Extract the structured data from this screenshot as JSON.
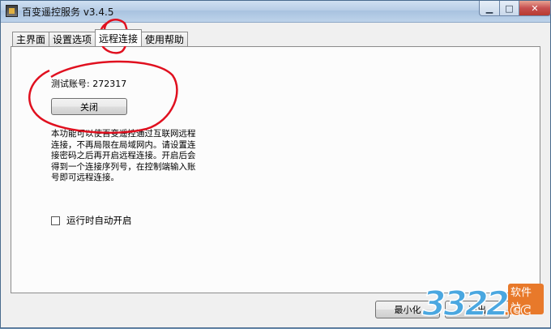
{
  "window": {
    "title": "百变遥控服务 v3.4.5",
    "controls": {
      "minimize": "▁",
      "maximize": "□",
      "close": "✕"
    }
  },
  "tabs": [
    {
      "label": "主界面",
      "active": false
    },
    {
      "label": "设置选项",
      "active": false
    },
    {
      "label": "远程连接",
      "active": true
    },
    {
      "label": "使用帮助",
      "active": false
    }
  ],
  "remote": {
    "test_account_label": "测试账号: 272317",
    "close_button": "关闭",
    "description": "本功能可以使百变遥控通过互联网远程连接，不再局限在局域网内。请设置连接密码之后再开启远程连接。开启后会得到一个连接序列号，在控制端输入账号即可远程连接。",
    "autostart_label": "运行时自动开启",
    "autostart_checked": false
  },
  "footer": {
    "minimize_button": "最小化",
    "exit_button": "退出"
  },
  "watermark": {
    "number": "3322",
    "site": "软件站",
    "domain": ".cc"
  },
  "colors": {
    "annotation": "#e0101f",
    "titlebar": "#b7cde6",
    "close_button": "#c75050"
  }
}
